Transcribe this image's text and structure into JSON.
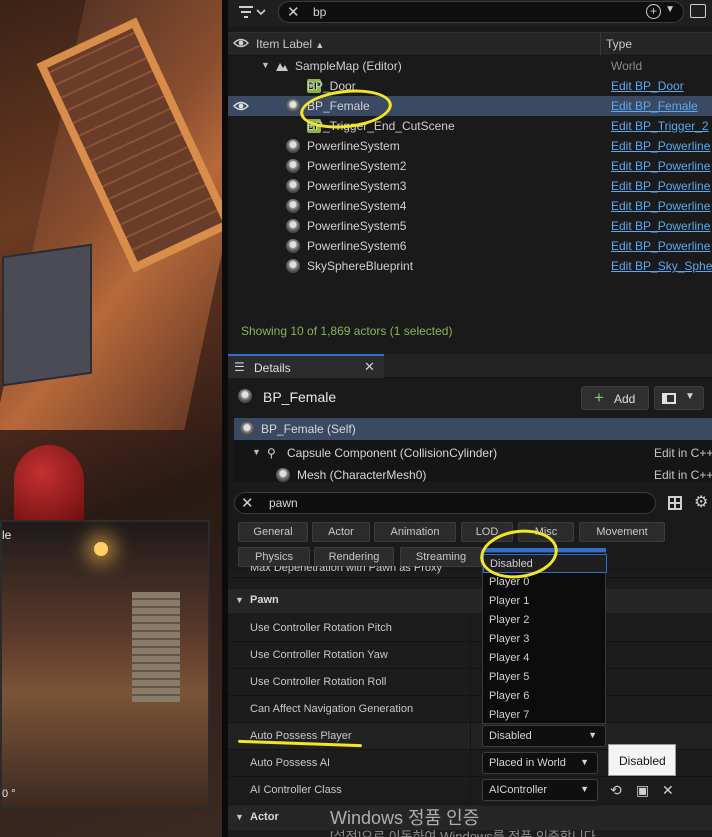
{
  "viewport": {
    "thumb_label": "le",
    "angle_label": "0 °"
  },
  "outliner": {
    "search_value": "bp",
    "columns": {
      "label": "Item Label",
      "sort_arrow": "▲",
      "type": "Type"
    },
    "root": {
      "label": "SampleMap (Editor)",
      "type": "World"
    },
    "items": [
      {
        "label": "BP_Door",
        "type": "Edit BP_Door",
        "icon": "blueprint-icon"
      },
      {
        "label": "BP_Female",
        "type": "Edit BP_Female",
        "icon": "pawn-icon",
        "selected": true
      },
      {
        "label": "BP_Trigger_End_CutScene",
        "type": "Edit BP_Trigger_2",
        "icon": "blueprint-icon"
      },
      {
        "label": "PowerlineSystem",
        "type": "Edit BP_Powerline",
        "icon": "pawn-icon"
      },
      {
        "label": "PowerlineSystem2",
        "type": "Edit BP_Powerline",
        "icon": "pawn-icon"
      },
      {
        "label": "PowerlineSystem3",
        "type": "Edit BP_Powerline",
        "icon": "pawn-icon"
      },
      {
        "label": "PowerlineSystem4",
        "type": "Edit BP_Powerline",
        "icon": "pawn-icon"
      },
      {
        "label": "PowerlineSystem5",
        "type": "Edit BP_Powerline",
        "icon": "pawn-icon"
      },
      {
        "label": "PowerlineSystem6",
        "type": "Edit BP_Powerline",
        "icon": "pawn-icon"
      },
      {
        "label": "SkySphereBlueprint",
        "type": "Edit BP_Sky_Sphe",
        "icon": "pawn-icon"
      }
    ],
    "status": "Showing 10 of 1,869 actors (1 selected)"
  },
  "details": {
    "tab_label": "Details",
    "actor_name": "BP_Female",
    "add_label": "Add",
    "components": [
      {
        "label": "BP_Female (Self)",
        "edit": "",
        "selected": true
      },
      {
        "label": "Capsule Component (CollisionCylinder)",
        "edit": "Edit in C++"
      },
      {
        "label": "Mesh (CharacterMesh0)",
        "edit": "Edit in C++"
      }
    ],
    "search_value": "pawn",
    "categories_row1": [
      "General",
      "Actor",
      "Animation",
      "LOD",
      "Misc",
      "Movement"
    ],
    "categories_row2": [
      "Physics",
      "Rendering",
      "Streaming"
    ],
    "clipped_row": "Max Depenetration with Pawn as Proxy",
    "pawn_section": "Pawn",
    "pawn_props": [
      "Use Controller Rotation Pitch",
      "Use Controller Rotation Yaw",
      "Use Controller Rotation Roll",
      "Can Affect Navigation Generation"
    ],
    "auto_possess_player": {
      "label": "Auto Possess Player",
      "value": "Disabled"
    },
    "auto_possess_ai": {
      "label": "Auto Possess AI",
      "value": "Placed in World"
    },
    "ai_controller": {
      "label": "AI Controller Class",
      "value": "AIController"
    },
    "actor_section": "Actor",
    "dropdown_options": [
      "Disabled",
      "Player 0",
      "Player 1",
      "Player 2",
      "Player 3",
      "Player 4",
      "Player 5",
      "Player 6",
      "Player 7"
    ],
    "tooltip": "Disabled"
  },
  "watermark": {
    "line1": "Windows 정품 인증",
    "line2": "[설정]으로 이동하여 Windows를 정품 인증합니다."
  },
  "colors": {
    "selection": "#3a4a63",
    "link": "#5da8f0",
    "status_green": "#8fb257",
    "highlight": "#f2e62a",
    "accent_blue": "#2f6fd0"
  }
}
